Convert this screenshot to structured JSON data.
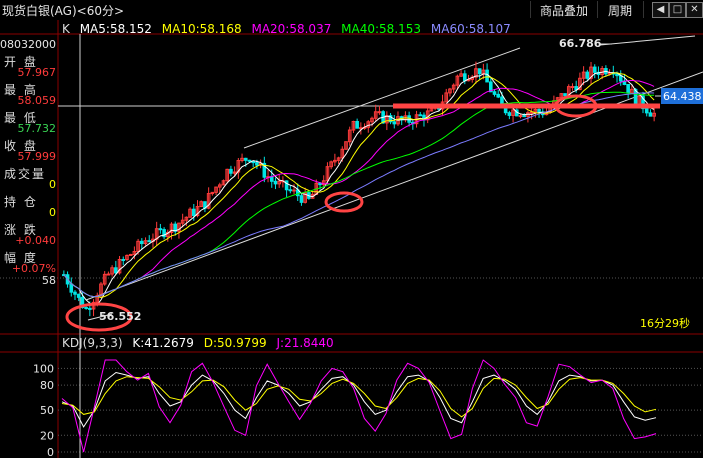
{
  "title": "现货白银(AG)<60分>",
  "toolbar": {
    "overlay_label": "商品叠加",
    "period_label": "周期"
  },
  "window_icons": [
    "back-icon",
    "forward-icon",
    "window-icon",
    "close-icon"
  ],
  "legend": {
    "k": "K",
    "ma5": "MA5:58.152",
    "ma10": "MA10:58.168",
    "ma20": "MA20:58.037",
    "ma40": "MA40:58.153",
    "ma60": "MA60:58.107"
  },
  "info": {
    "date": "08032000",
    "open_label": "开 盘",
    "open": "57.967",
    "high_label": "最 高",
    "high": "58.059",
    "low_label": "最 低",
    "low": "57.732",
    "close_label": "收 盘",
    "close": "57.999",
    "volume_label": "成交量",
    "volume": "0",
    "position_label": "持 仓",
    "position": "0",
    "change_label": "涨 跌",
    "change": "+0.040",
    "amplitude_label": "幅 度",
    "amplitude": "+0.07%"
  },
  "axis": {
    "price_tick": "58",
    "current_price": "64.438",
    "kdj_ticks": [
      "100",
      "80",
      "50",
      "20",
      "0"
    ]
  },
  "annotations": {
    "high_marker": "66.786",
    "low_marker": "56.552",
    "countdown": "16分29秒"
  },
  "kdj_legend": {
    "name": "KDJ(9,3,3)",
    "k": "K:41.2679",
    "d": "D:50.9799",
    "j": "J:21.8440"
  },
  "colors": {
    "up": "#ff3b3b",
    "down": "#00e5e5",
    "ma5": "#ffffff",
    "ma10": "#ffff00",
    "ma20": "#ff00ff",
    "ma40": "#00ff00",
    "ma60": "#7b7bff",
    "highlight": "#ff4444",
    "price_box": "#1e6fd9"
  },
  "chart_data": [
    {
      "type": "candlestick",
      "title": "现货白银(AG)<60分>",
      "ylim": [
        56.0,
        67.5
      ],
      "marked_levels": [
        64.438
      ],
      "annotated_high": 66.786,
      "annotated_low": 56.552,
      "trend": [
        {
          "t": 0,
          "v": 58.0
        },
        {
          "t": 4,
          "v": 57.0
        },
        {
          "t": 6,
          "v": 56.6
        },
        {
          "t": 12,
          "v": 58.0
        },
        {
          "t": 22,
          "v": 59.4
        },
        {
          "t": 30,
          "v": 60.0
        },
        {
          "t": 38,
          "v": 60.9
        },
        {
          "t": 44,
          "v": 62.2
        },
        {
          "t": 50,
          "v": 62.8
        },
        {
          "t": 56,
          "v": 61.8
        },
        {
          "t": 62,
          "v": 61.3
        },
        {
          "t": 66,
          "v": 61.0
        },
        {
          "t": 72,
          "v": 62.4
        },
        {
          "t": 78,
          "v": 64.0
        },
        {
          "t": 84,
          "v": 64.4
        },
        {
          "t": 92,
          "v": 64.2
        },
        {
          "t": 100,
          "v": 64.6
        },
        {
          "t": 106,
          "v": 66.0
        },
        {
          "t": 112,
          "v": 66.3
        },
        {
          "t": 118,
          "v": 64.7
        },
        {
          "t": 124,
          "v": 64.6
        },
        {
          "t": 130,
          "v": 64.6
        },
        {
          "t": 136,
          "v": 65.5
        },
        {
          "t": 142,
          "v": 66.2
        },
        {
          "t": 148,
          "v": 66.4
        },
        {
          "t": 154,
          "v": 65.1
        },
        {
          "t": 159,
          "v": 64.5
        }
      ],
      "series": [
        {
          "name": "MA5",
          "value": 58.152
        },
        {
          "name": "MA10",
          "value": 58.168
        },
        {
          "name": "MA20",
          "value": 58.037
        },
        {
          "name": "MA40",
          "value": 58.153
        },
        {
          "name": "MA60",
          "value": 58.107
        }
      ]
    },
    {
      "type": "line",
      "title": "KDJ(9,3,3)",
      "ylim": [
        0,
        110
      ],
      "yticks": [
        0,
        20,
        50,
        80,
        100
      ],
      "latest": {
        "K": 41.2679,
        "D": 50.9799,
        "J": 21.844
      },
      "series": [
        {
          "name": "K",
          "values": [
            60,
            55,
            30,
            50,
            85,
            95,
            92,
            88,
            90,
            70,
            55,
            60,
            80,
            92,
            85,
            70,
            50,
            40,
            65,
            85,
            80,
            70,
            55,
            60,
            75,
            88,
            90,
            80,
            60,
            45,
            50,
            72,
            90,
            92,
            85,
            65,
            40,
            35,
            60,
            88,
            92,
            85,
            75,
            55,
            45,
            60,
            85,
            92,
            90,
            85,
            86,
            80,
            60,
            42,
            38,
            41
          ]
        },
        {
          "name": "D",
          "values": [
            58,
            56,
            45,
            48,
            70,
            85,
            90,
            89,
            88,
            78,
            65,
            62,
            72,
            85,
            86,
            78,
            62,
            50,
            58,
            75,
            79,
            75,
            63,
            61,
            70,
            82,
            87,
            82,
            70,
            55,
            52,
            65,
            82,
            88,
            86,
            73,
            52,
            42,
            52,
            76,
            88,
            87,
            80,
            65,
            52,
            57,
            75,
            87,
            89,
            86,
            86,
            82,
            70,
            55,
            48,
            51
          ]
        },
        {
          "name": "J",
          "values": [
            64,
            53,
            0,
            54,
            110,
            110,
            96,
            86,
            94,
            54,
            35,
            56,
            96,
            106,
            83,
            54,
            26,
            20,
            79,
            105,
            82,
            60,
            39,
            58,
            85,
            100,
            96,
            76,
            40,
            25,
            46,
            86,
            106,
            100,
            83,
            49,
            16,
            21,
            76,
            110,
            100,
            81,
            65,
            35,
            31,
            66,
            105,
            102,
            92,
            83,
            86,
            76,
            40,
            16,
            18,
            22
          ]
        }
      ]
    }
  ]
}
